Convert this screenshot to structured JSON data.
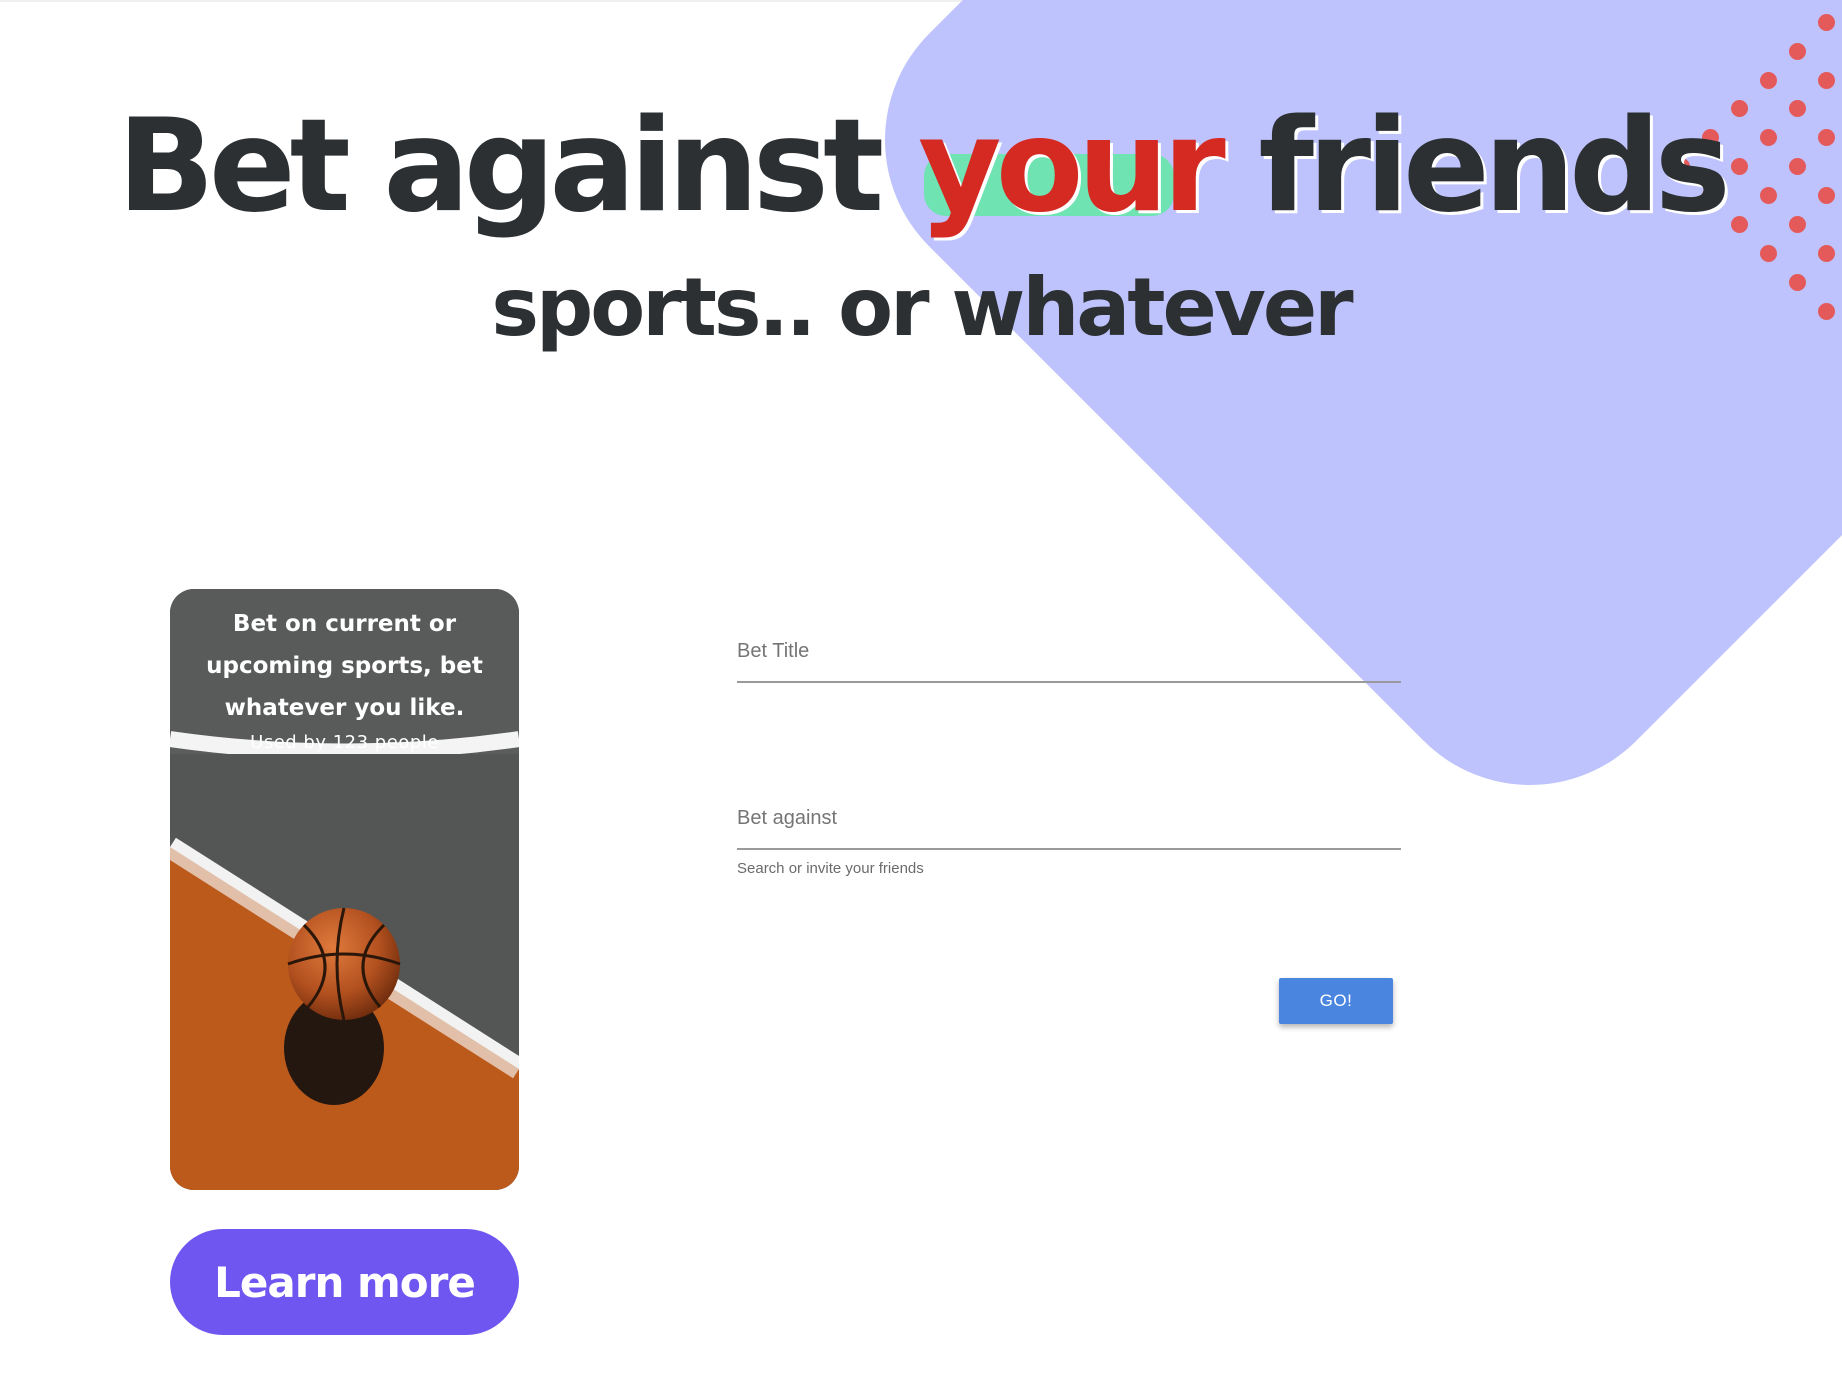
{
  "hero": {
    "title_part1": "Bet against",
    "title_accent": "your",
    "title_part2": "friends",
    "subtitle": "sports.. or whatever"
  },
  "card": {
    "caption": "Bet on current or upcoming sports, bet whatever you like.",
    "users": "Used by 123 people",
    "image_icon": "basketball-court-image"
  },
  "cta": {
    "learn_more_label": "Learn more"
  },
  "form": {
    "bet_title_placeholder": "Bet Title",
    "bet_against_placeholder": "Bet against",
    "bet_against_help": "Search or invite your friends",
    "go_label": "GO!"
  },
  "colors": {
    "blob": "#bec3fd",
    "accent_red": "#d52a22",
    "highlight_green": "#6fe3b1",
    "dots": "#e45a5a",
    "button_purple": "#6f56f0",
    "go_blue": "#4a86df",
    "text_dark": "#2c3033"
  }
}
